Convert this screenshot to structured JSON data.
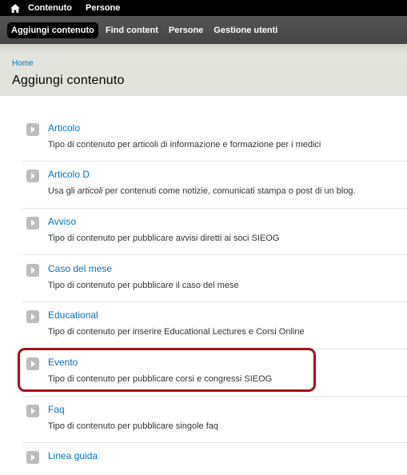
{
  "toolbar": {
    "items": [
      "Contenuto",
      "Persone"
    ]
  },
  "shortcuts": [
    "Aggiungi contenuto",
    "Find content",
    "Persone",
    "Gestione utenti"
  ],
  "breadcrumb": "Home",
  "page_title": "Aggiungi contenuto",
  "content_types": [
    {
      "title": "Articolo",
      "desc": "Tipo di contenuto per articoli di informazione e formazione per i medici"
    },
    {
      "title": "Articolo D",
      "desc_before": "Usa gli ",
      "desc_em": "articoli",
      "desc_after": " per contenuti come notizie, comunicati stampa o post di un blog."
    },
    {
      "title": "Avviso",
      "desc": "Tipo di contenuto per pubblicare avvisi diretti ai soci SIEOG"
    },
    {
      "title": "Caso del mese",
      "desc": "Tipo di contenuto per pubblicare il caso del mese"
    },
    {
      "title": "Educational",
      "desc": "Tipo di contenuto per inserire Educational Lectures e Corsi Online"
    },
    {
      "title": "Evento",
      "desc": "Tipo di contenuto per pubblicare corsi e congressi SIEOG"
    },
    {
      "title": "Faq",
      "desc": "Tipo di contenuto per pubblicare singole faq"
    },
    {
      "title": "Linea guida",
      "desc": ""
    }
  ],
  "colors": {
    "link": "#0074bd",
    "highlight": "#a3131b"
  }
}
